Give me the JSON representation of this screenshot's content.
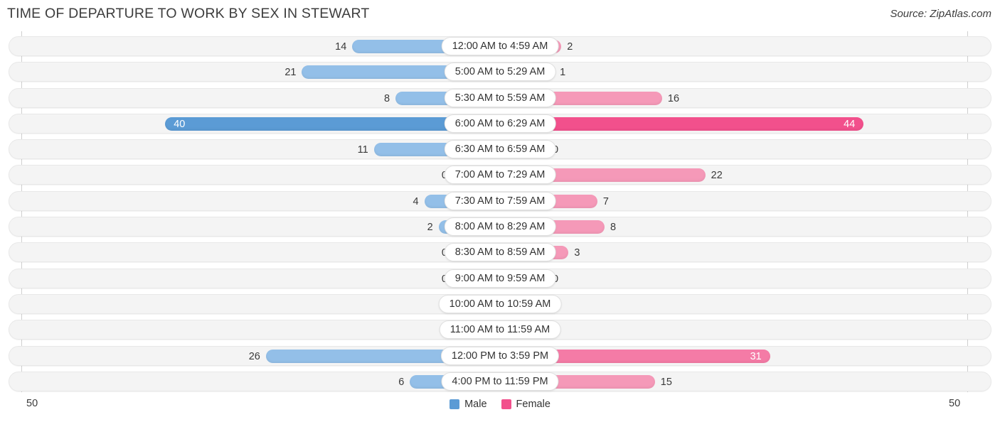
{
  "header": {
    "title": "TIME OF DEPARTURE TO WORK BY SEX IN STEWART",
    "source": "Source: ZipAtlas.com"
  },
  "axis": {
    "left_tick": "50",
    "right_tick": "50",
    "max": 50
  },
  "legend": {
    "items": [
      {
        "label": "Male",
        "color": "#5b9bd5"
      },
      {
        "label": "Female",
        "color": "#f2508c"
      }
    ]
  },
  "chart_data": {
    "type": "bar",
    "title": "TIME OF DEPARTURE TO WORK BY SEX IN STEWART",
    "orientation": "horizontal-diverging",
    "xlabel": "",
    "ylabel": "",
    "xlim": [
      50,
      50
    ],
    "grid": false,
    "legend_position": "bottom-center",
    "categories": [
      "12:00 AM to 4:59 AM",
      "5:00 AM to 5:29 AM",
      "5:30 AM to 5:59 AM",
      "6:00 AM to 6:29 AM",
      "6:30 AM to 6:59 AM",
      "7:00 AM to 7:29 AM",
      "7:30 AM to 7:59 AM",
      "8:00 AM to 8:29 AM",
      "8:30 AM to 8:59 AM",
      "9:00 AM to 9:59 AM",
      "10:00 AM to 10:59 AM",
      "11:00 AM to 11:59 AM",
      "12:00 PM to 3:59 PM",
      "4:00 PM to 11:59 PM"
    ],
    "series": [
      {
        "name": "Male",
        "color": "#5b9bd5",
        "values": [
          14,
          21,
          8,
          40,
          11,
          0,
          4,
          2,
          0,
          0,
          0,
          0,
          26,
          6
        ]
      },
      {
        "name": "Female",
        "color": "#f2508c",
        "values": [
          2,
          1,
          16,
          44,
          0,
          22,
          7,
          8,
          3,
          0,
          0,
          0,
          31,
          15
        ]
      }
    ]
  }
}
